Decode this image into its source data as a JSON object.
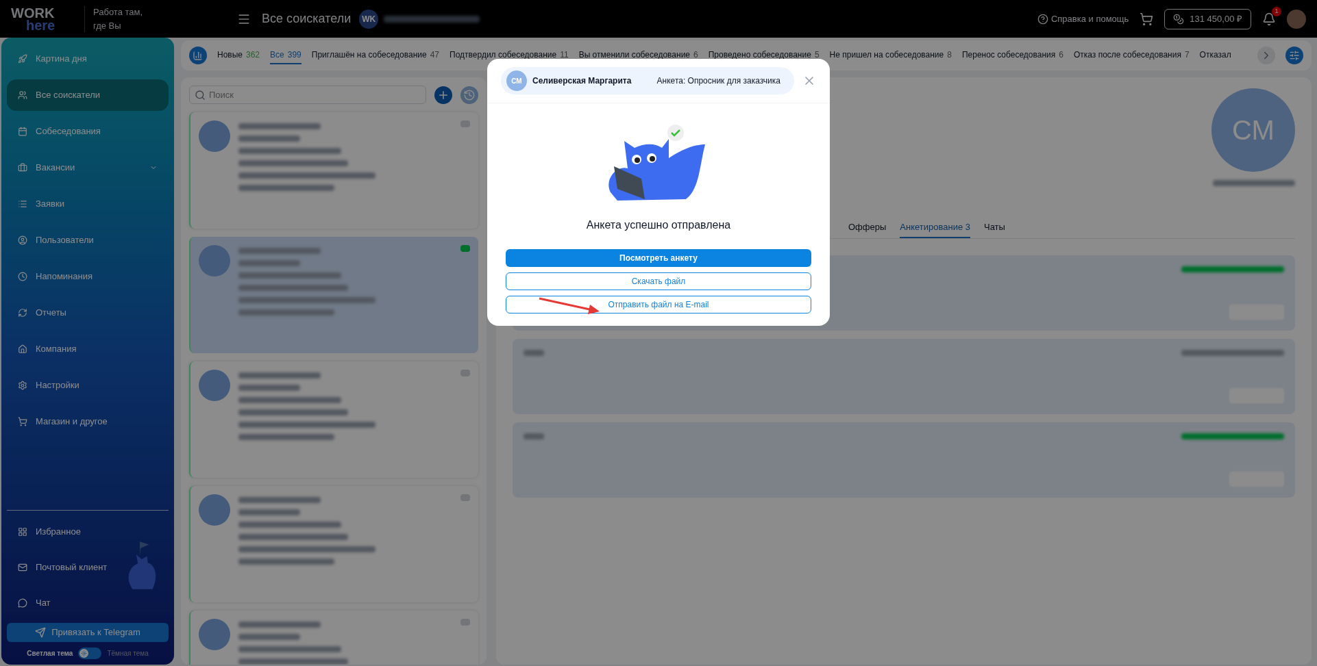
{
  "header": {
    "logo_top": "WORK",
    "logo_bottom": "here",
    "slogan": "Работа там,\nгде Вы",
    "page_title": "Все соискатели",
    "company_initials": "WK",
    "help": "Справка и помощь",
    "balance": "131 450,00 ₽",
    "notifications": "1"
  },
  "sidebar": {
    "items": [
      {
        "label": "Картина дня",
        "selected": false
      },
      {
        "label": "Все соискатели",
        "selected": true
      },
      {
        "label": "Собеседования",
        "selected": false
      },
      {
        "label": "Вакансии",
        "selected": false,
        "expandable": true
      },
      {
        "label": "Заявки",
        "selected": false
      },
      {
        "label": "Пользователи",
        "selected": false
      },
      {
        "label": "Напоминания",
        "selected": false
      },
      {
        "label": "Отчеты",
        "selected": false
      },
      {
        "label": "Компания",
        "selected": false
      },
      {
        "label": "Настройки",
        "selected": false
      },
      {
        "label": "Магазин и другое",
        "selected": false
      }
    ],
    "bottom_items": [
      {
        "label": "Избранное"
      },
      {
        "label": "Почтовый клиент"
      },
      {
        "label": "Чат"
      }
    ],
    "telegram_button": "Привязать к Telegram",
    "theme": {
      "light_label": "Светлая тема",
      "dark_label": "Тёмная тема",
      "dark": false
    }
  },
  "status_tabs": [
    {
      "label": "Новые",
      "count": "362",
      "highlight": true,
      "selected": false
    },
    {
      "label": "Все",
      "count": "399",
      "highlight": false,
      "selected": true
    },
    {
      "label": "Приглашён на собеседование",
      "count": "47",
      "highlight": false,
      "selected": false
    },
    {
      "label": "Подтвердил собеседование",
      "count": "11",
      "highlight": false,
      "selected": false
    },
    {
      "label": "Вы отменили собеседование",
      "count": "6",
      "highlight": false,
      "selected": false
    },
    {
      "label": "Проведено собеседование",
      "count": "5",
      "highlight": false,
      "selected": false
    },
    {
      "label": "Не пришел на собеседование",
      "count": "8",
      "highlight": false,
      "selected": false
    },
    {
      "label": "Перенос собеседования",
      "count": "6",
      "highlight": false,
      "selected": false
    },
    {
      "label": "Отказ после собеседования",
      "count": "7",
      "highlight": false,
      "selected": false
    },
    {
      "label": "Отказал",
      "selected": false
    }
  ],
  "search": {
    "placeholder": "Поиск"
  },
  "candidates": [
    {
      "selected": false,
      "flagged": false
    },
    {
      "selected": true,
      "flagged": true
    },
    {
      "selected": false,
      "flagged": false
    },
    {
      "selected": false,
      "flagged": false
    },
    {
      "selected": false,
      "flagged": false
    }
  ],
  "profile": {
    "initials": "СМ",
    "tabs": [
      {
        "label": "Офферы",
        "selected": false
      },
      {
        "label": "Анкетирование",
        "count": "3",
        "selected": true
      },
      {
        "label": "Чаты",
        "selected": false
      }
    ]
  },
  "modal": {
    "initials": "СМ",
    "name": "Селиверская Маргарита",
    "form": "Анкета: Опросник для заказчика",
    "message": "Анкета успешно отправлена",
    "buttons": [
      {
        "label": "Посмотреть анкету",
        "kind": "primary"
      },
      {
        "label": "Скачать файл",
        "kind": "outline"
      },
      {
        "label": "Отправить файл на E-mail",
        "kind": "outline"
      }
    ]
  }
}
